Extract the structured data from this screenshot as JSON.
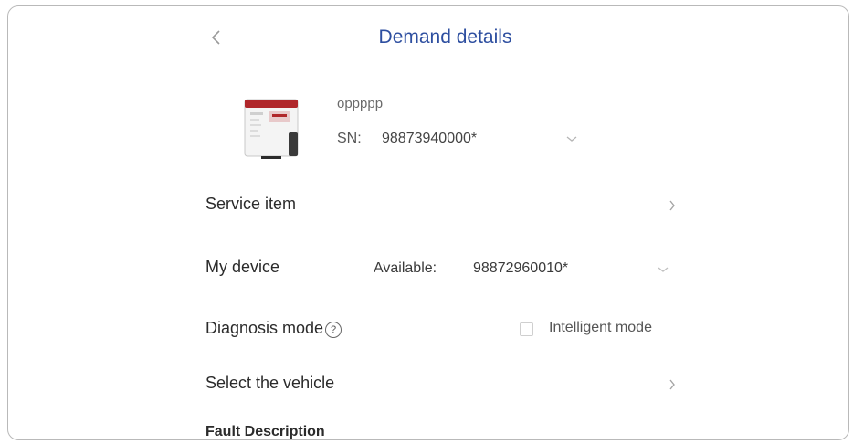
{
  "header": {
    "title": "Demand details",
    "back_icon": "chevron-left-icon"
  },
  "product": {
    "name": "oppppp",
    "sn_label": "SN:",
    "sn_value": "98873940000*",
    "thumbnail_icon": "tablet-device-icon"
  },
  "rows": {
    "service_item": {
      "label": "Service item"
    },
    "my_device": {
      "label": "My device",
      "available_label": "Available:",
      "available_value": "98872960010*"
    },
    "diagnosis_mode": {
      "label": "Diagnosis mode",
      "help_icon_text": "?",
      "option_label": "Intelligent mode",
      "option_checked": false
    },
    "select_vehicle": {
      "label": "Select the vehicle"
    }
  },
  "fault": {
    "title": "Fault Description"
  },
  "colors": {
    "title_blue": "#2e4fa0",
    "device_red": "#b0262a"
  }
}
